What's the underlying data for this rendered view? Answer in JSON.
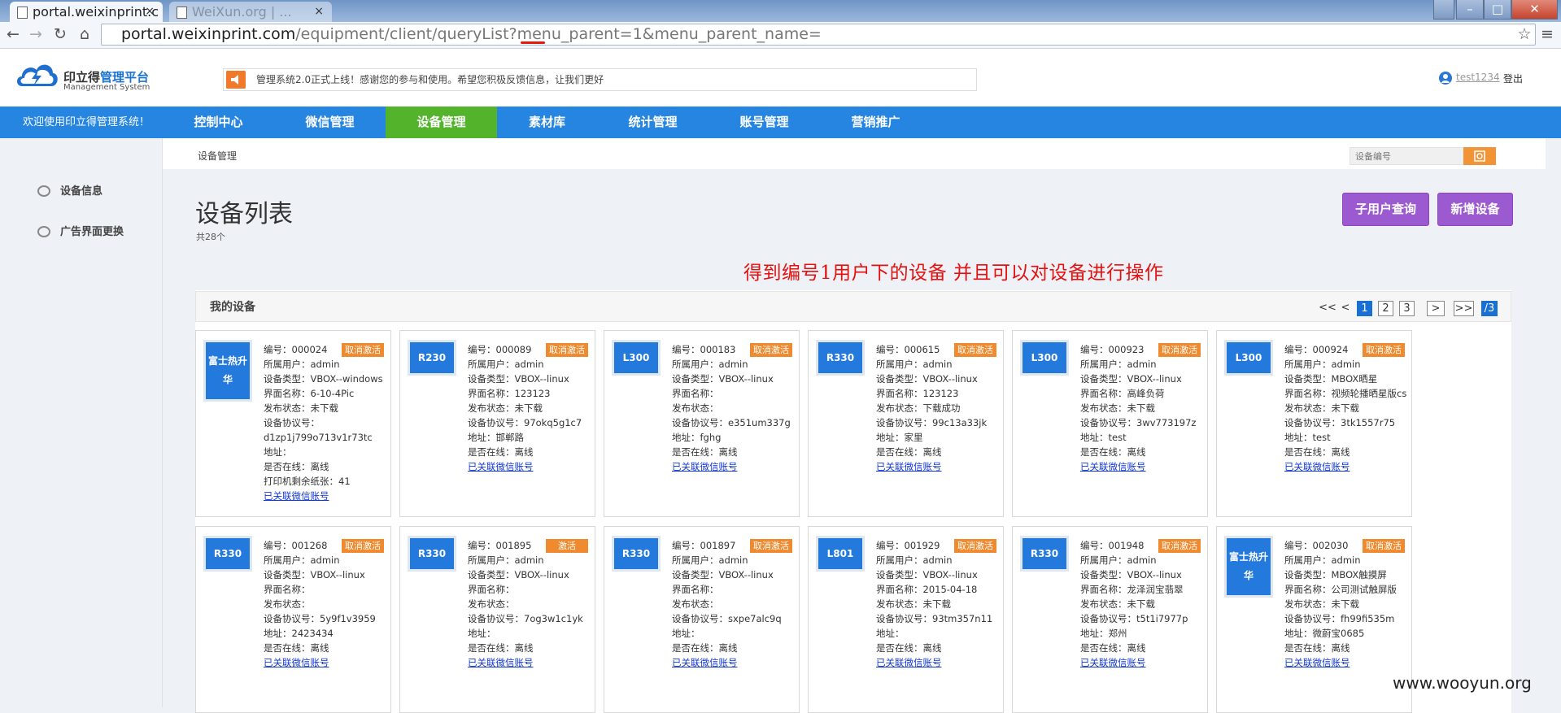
{
  "browser": {
    "active_tab_title": "portal.weixinprint.c",
    "inactive_tab_title": "WeiXun.org | ...",
    "tab_close": "×",
    "url_host": "portal.weixinprint.com",
    "url_path": "/equipment/client/queryList?menu_parent=1&menu_parent_name=",
    "window_controls": [
      "–",
      "□",
      "✕"
    ],
    "nav": [
      "←",
      "→",
      "↻",
      "⌂"
    ],
    "star": "☆",
    "menu": "≡"
  },
  "header": {
    "logo_cn_a": "印立得",
    "logo_cn_b": "管理平台",
    "logo_en": "Management System",
    "notice": "管理系统2.0正式上线！感谢您的参与和使用。希望您积极反馈信息，让我们更好",
    "username": "test1234",
    "logout": "登出"
  },
  "nav": {
    "welcome": "欢迎使用印立得管理系统！",
    "items": [
      "控制中心",
      "微信管理",
      "设备管理",
      "素材库",
      "统计管理",
      "账号管理",
      "营销推广"
    ],
    "active": "设备管理"
  },
  "sidebar": {
    "items": [
      "设备信息",
      "广告界面更换"
    ]
  },
  "content": {
    "breadcrumb": "设备管理",
    "search_placeholder": "设备编号",
    "title": "设备列表",
    "count": "共28个",
    "btn_sub_user": "子用户查询",
    "btn_add_device": "新增设备",
    "annotation": "得到编号1用户下的设备  并且可以对设备进行操作",
    "panel_title": "我的设备",
    "pager": [
      "<<",
      "<",
      "1",
      "2",
      "3",
      ">",
      ">>",
      "/3"
    ]
  },
  "devices": [
    {
      "model": "富士热升华",
      "badge": "取消激活",
      "lines": [
        "编号：000024",
        "所属用户：admin",
        "设备类型：VBOX--windows",
        "界面名称：6-10-4Pic",
        "发布状态：未下载",
        "设备协议号：",
        "d1zp1j799o713v1r73tc",
        "地址：",
        "是否在线：离线",
        "打印机剩余纸张：41"
      ],
      "link": "已关联微信账号"
    },
    {
      "model": "R230",
      "badge": "取消激活",
      "lines": [
        "编号：000089",
        "所属用户：admin",
        "设备类型：VBOX--linux",
        "界面名称：123123",
        "发布状态：未下载",
        "设备协议号：97okq5g1c7",
        "地址：邯郸路",
        "是否在线：离线"
      ],
      "link": "已关联微信账号"
    },
    {
      "model": "L300",
      "badge": "取消激活",
      "lines": [
        "编号：000183",
        "所属用户：admin",
        "设备类型：VBOX--linux",
        "界面名称：",
        "发布状态：",
        "设备协议号：e351um337g",
        "地址：fghg",
        "是否在线：离线"
      ],
      "link": "已关联微信账号"
    },
    {
      "model": "R330",
      "badge": "取消激活",
      "lines": [
        "编号：000615",
        "所属用户：admin",
        "设备类型：VBOX--linux",
        "界面名称：123123",
        "发布状态：下载成功",
        "设备协议号：99c13a33jk",
        "地址：家里",
        "是否在线：离线"
      ],
      "link": "已关联微信账号"
    },
    {
      "model": "L300",
      "badge": "取消激活",
      "lines": [
        "编号：000923",
        "所属用户：admin",
        "设备类型：VBOX--linux",
        "界面名称：高峰负荷",
        "发布状态：未下载",
        "设备协议号：3wv773197z",
        "地址：test",
        "是否在线：离线"
      ],
      "link": "已关联微信账号"
    },
    {
      "model": "L300",
      "badge": "取消激活",
      "lines": [
        "编号：000924",
        "所属用户：admin",
        "设备类型：MBOX晒星",
        "界面名称：视频轮播晒星版cs",
        "发布状态：未下载",
        "设备协议号：3tk1557r75",
        "地址：test",
        "是否在线：离线"
      ],
      "link": "已关联微信账号"
    },
    {
      "model": "R330",
      "badge": "取消激活",
      "lines": [
        "编号：001268",
        "所属用户：admin",
        "设备类型：VBOX--linux",
        "界面名称：",
        "发布状态：",
        "设备协议号：5y9f1v3959",
        "地址：2423434",
        "是否在线：离线"
      ],
      "link": "已关联微信账号"
    },
    {
      "model": "R330",
      "badge": "激活",
      "lines": [
        "编号：001895",
        "所属用户：admin",
        "设备类型：VBOX--linux",
        "界面名称：",
        "发布状态：",
        "设备协议号：7og3w1c1yk",
        "地址：",
        "是否在线：离线"
      ],
      "link": "已关联微信账号"
    },
    {
      "model": "R330",
      "badge": "取消激活",
      "lines": [
        "编号：001897",
        "所属用户：admin",
        "设备类型：VBOX--linux",
        "界面名称：",
        "发布状态：",
        "设备协议号：sxpe7alc9q",
        "地址：",
        "是否在线：离线"
      ],
      "link": "已关联微信账号"
    },
    {
      "model": "L801",
      "badge": "取消激活",
      "lines": [
        "编号：001929",
        "所属用户：admin",
        "设备类型：VBOX--linux",
        "界面名称：2015-04-18",
        "发布状态：未下载",
        "设备协议号：93tm357n11",
        "地址：",
        "是否在线：离线"
      ],
      "link": "已关联微信账号"
    },
    {
      "model": "R330",
      "badge": "取消激活",
      "lines": [
        "编号：001948",
        "所属用户：admin",
        "设备类型：VBOX--linux",
        "界面名称：龙泽润宝翡翠",
        "发布状态：未下载",
        "设备协议号：t5t1i7977p",
        "地址：郑州",
        "是否在线：离线"
      ],
      "link": "已关联微信账号"
    },
    {
      "model": "富士热升华",
      "badge": "取消激活",
      "lines": [
        "编号：002030",
        "所属用户：admin",
        "设备类型：MBOX触摸屏",
        "界面名称：公司测试触屏版",
        "发布状态：未下载",
        "设备协议号：fh99fi535m",
        "地址：微蔚宝0685",
        "是否在线：离线"
      ],
      "link": "已关联微信账号"
    }
  ],
  "watermark": "www.wooyun.org",
  "colors": {
    "nav_blue": "#2585e0",
    "nav_active_green": "#53b42c",
    "purple_button": "#9c5ad1",
    "badge_orange": "#f08a2e",
    "model_blue": "#2479dc",
    "annotation_red": "#e51010"
  }
}
